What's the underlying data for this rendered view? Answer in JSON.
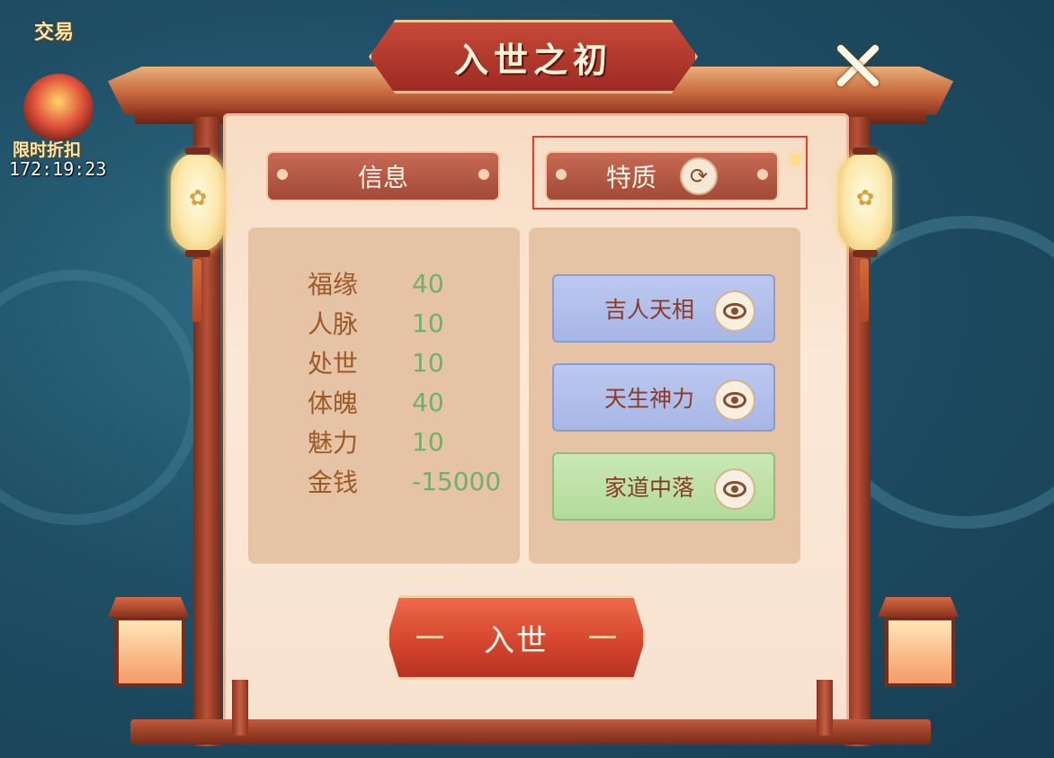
{
  "background": {
    "trade_label": "交易",
    "sale_label": "限时折扣",
    "sale_timer": "172:19:23"
  },
  "dialog": {
    "title": "入世之初",
    "tabs": {
      "info": "信息",
      "traits": "特质"
    },
    "stats": [
      {
        "name": "福缘",
        "value": "40"
      },
      {
        "name": "人脉",
        "value": "10"
      },
      {
        "name": "处世",
        "value": "10"
      },
      {
        "name": "体魄",
        "value": "40"
      },
      {
        "name": "魅力",
        "value": "10"
      },
      {
        "name": "金钱",
        "value": "-15000"
      }
    ],
    "traits": [
      {
        "name": "吉人天相",
        "color": "blue"
      },
      {
        "name": "天生神力",
        "color": "blue"
      },
      {
        "name": "家道中落",
        "color": "green"
      }
    ],
    "confirm_button": "入世"
  },
  "colors": {
    "stat_value": "#6fb06c",
    "stat_name": "#9a5a2a",
    "highlight": "#e23b2a"
  },
  "icons": [
    "close-icon",
    "refresh-icon",
    "eye-icon",
    "lantern-icon"
  ]
}
